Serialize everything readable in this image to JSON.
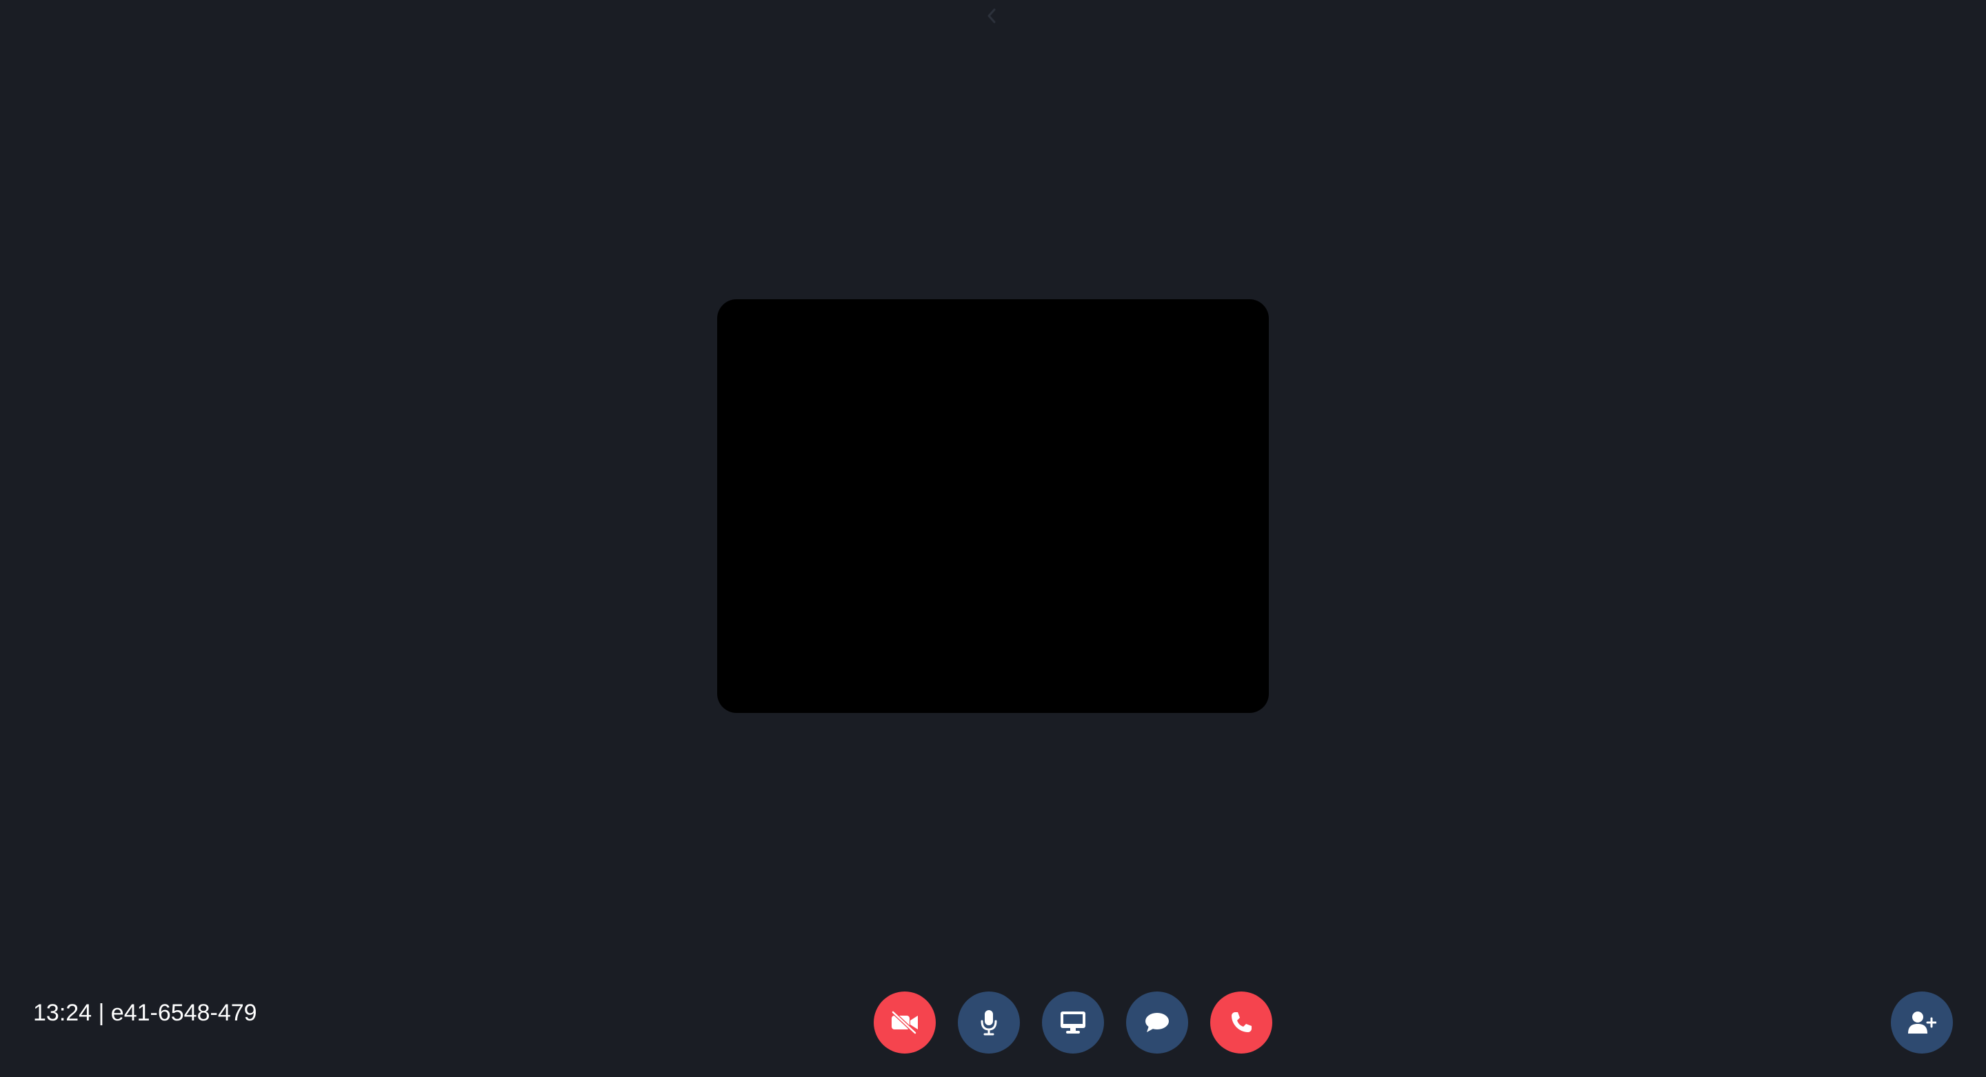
{
  "header": {
    "collapse_icon": "chevron-left-icon"
  },
  "video": {
    "tile_color": "#000000"
  },
  "footer": {
    "meeting_info": "13:24 | e41-6548-479"
  },
  "controls": [
    {
      "id": "camera",
      "icon": "video-off-icon",
      "state": "off",
      "color": "#f5444e"
    },
    {
      "id": "microphone",
      "icon": "microphone-icon",
      "state": "on",
      "color": "#2e4a70"
    },
    {
      "id": "screen-share",
      "icon": "desktop-icon",
      "color": "#2e4a70"
    },
    {
      "id": "chat",
      "icon": "chat-bubble-icon",
      "color": "#2e4a70"
    },
    {
      "id": "leave-call",
      "icon": "phone-icon",
      "color": "#f5444e"
    }
  ],
  "add_participant": {
    "icon": "user-plus-icon",
    "color": "#2e4a70"
  },
  "theme": {
    "background": "#1a1d24",
    "danger": "#f5444e",
    "neutral": "#2e4a70",
    "text": "#ffffff"
  }
}
